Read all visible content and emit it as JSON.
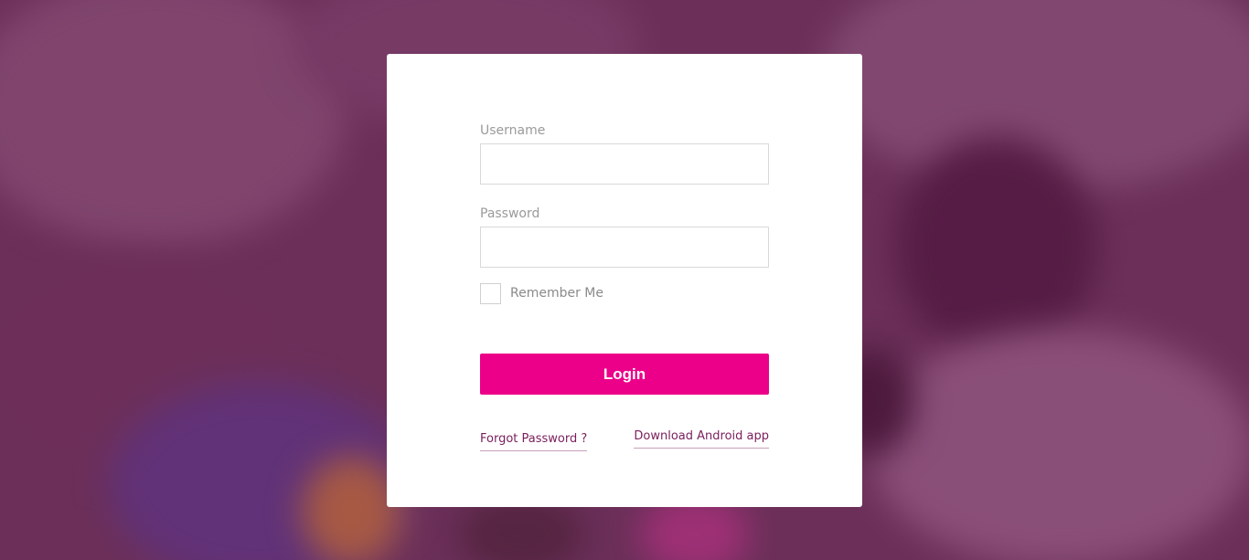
{
  "login_form": {
    "username_label": "Username",
    "username_value": "",
    "password_label": "Password",
    "password_value": "",
    "remember_label": "Remember Me",
    "remember_checked": false,
    "login_button": "Login",
    "forgot_password_link": "Forgot Password ?",
    "download_app_link": "Download Android app"
  },
  "colors": {
    "accent": "#ec0089",
    "link": "#7a1e5c",
    "background_tint": "#6e1e55"
  }
}
